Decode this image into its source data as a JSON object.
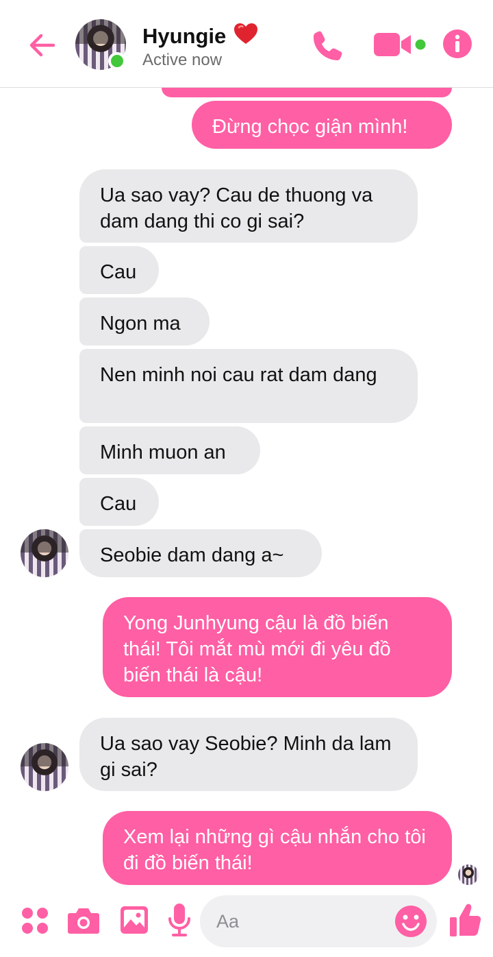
{
  "theme": {
    "accent": "#ff5fa4",
    "incoming_bubble": "#e9e9eb",
    "active_green": "#42c83a"
  },
  "header": {
    "contact_name": "Hyungie",
    "heart_icon": "red-heart-icon",
    "status": "Active now",
    "icons": [
      "back-arrow-icon",
      "phone-icon",
      "video-camera-icon",
      "info-icon"
    ]
  },
  "messages": [
    {
      "from": "me",
      "text": "Đừng chọc giận mình!"
    },
    {
      "from": "them",
      "text": "Ua sao vay? Cau de thuong va dam dang thi co gi sai?"
    },
    {
      "from": "them",
      "text": "Cau"
    },
    {
      "from": "them",
      "text": "Ngon ma"
    },
    {
      "from": "them",
      "text": "Nen minh noi cau rat dam dang"
    },
    {
      "from": "them",
      "text": "Minh muon an"
    },
    {
      "from": "them",
      "text": "Cau"
    },
    {
      "from": "them",
      "text": "Seobie dam dang a~"
    },
    {
      "from": "me",
      "text": "Yong Junhyung cậu là đồ biến thái! Tôi mắt mù mới đi yêu đồ biến thái là cậu!"
    },
    {
      "from": "them",
      "text": "Ua sao vay Seobie? Minh da lam gi sai?"
    },
    {
      "from": "me",
      "text": "Xem lại những gì cậu nhắn cho tôi đi đồ biến thái!"
    }
  ],
  "composer": {
    "placeholder": "Aa",
    "icons": [
      "apps-grid-icon",
      "camera-icon",
      "gallery-icon",
      "microphone-icon",
      "emoji-icon",
      "thumbs-up-icon"
    ]
  }
}
